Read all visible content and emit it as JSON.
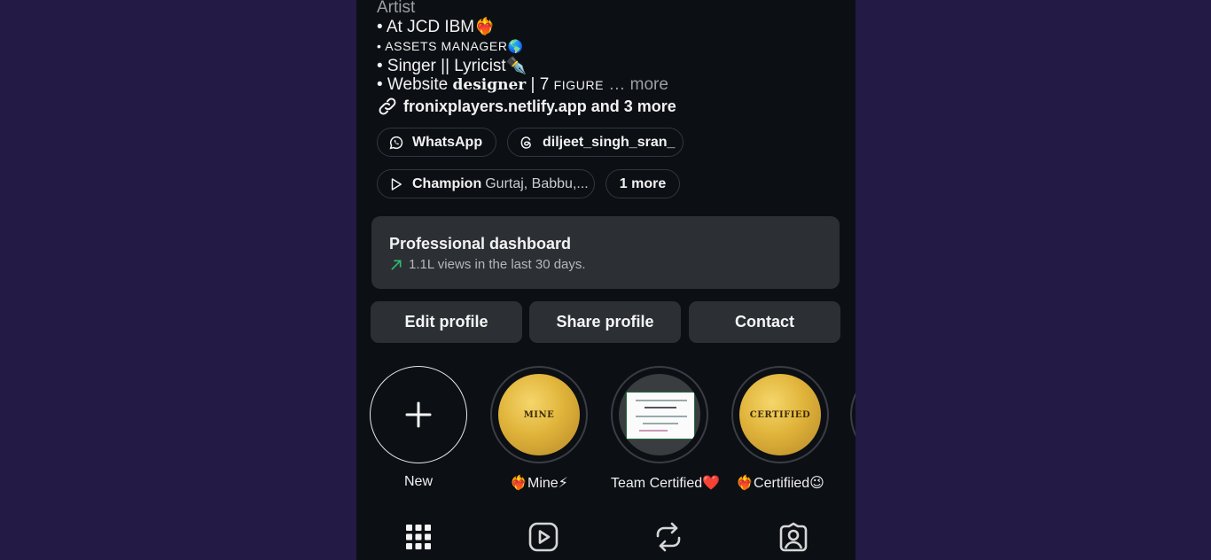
{
  "bio": {
    "lines": [
      "Artist",
      "• At JCD IBM❤️‍🔥",
      "• ASSETS MANAGER🌎",
      "• Singer || Lyricist✒️",
      "• Website ",
      "designer",
      " | 7 ",
      "FIGURE",
      " … more"
    ],
    "link_text": "fronixplayers.netlify.app and 3 more"
  },
  "pills": {
    "whatsapp": "WhatsApp",
    "threads": "diljeet_singh_sran_",
    "music_title": "Champion",
    "music_artists": "Gurtaj, Babbu,...",
    "more": "1 more"
  },
  "dashboard": {
    "title": "Professional dashboard",
    "subtitle": "1.1L views in the last 30 days."
  },
  "buttons": {
    "edit": "Edit profile",
    "share": "Share profile",
    "contact": "Contact"
  },
  "highlights": [
    {
      "label": "New",
      "icon": "plus-icon"
    },
    {
      "label": "❤️‍🔥Mine⚡",
      "cover_text": "MINE"
    },
    {
      "label": "Team Certified❤️"
    },
    {
      "label": "❤️‍🔥Certifiied😉",
      "cover_text": "CERTIFIED"
    }
  ],
  "tabs": [
    "grid-icon",
    "reels-icon",
    "reposts-icon",
    "tagged-icon"
  ],
  "colors": {
    "background": "#231a45",
    "phone_bg": "#0c0f14",
    "surface": "#2c3035",
    "trend_green": "#2fbf71"
  }
}
